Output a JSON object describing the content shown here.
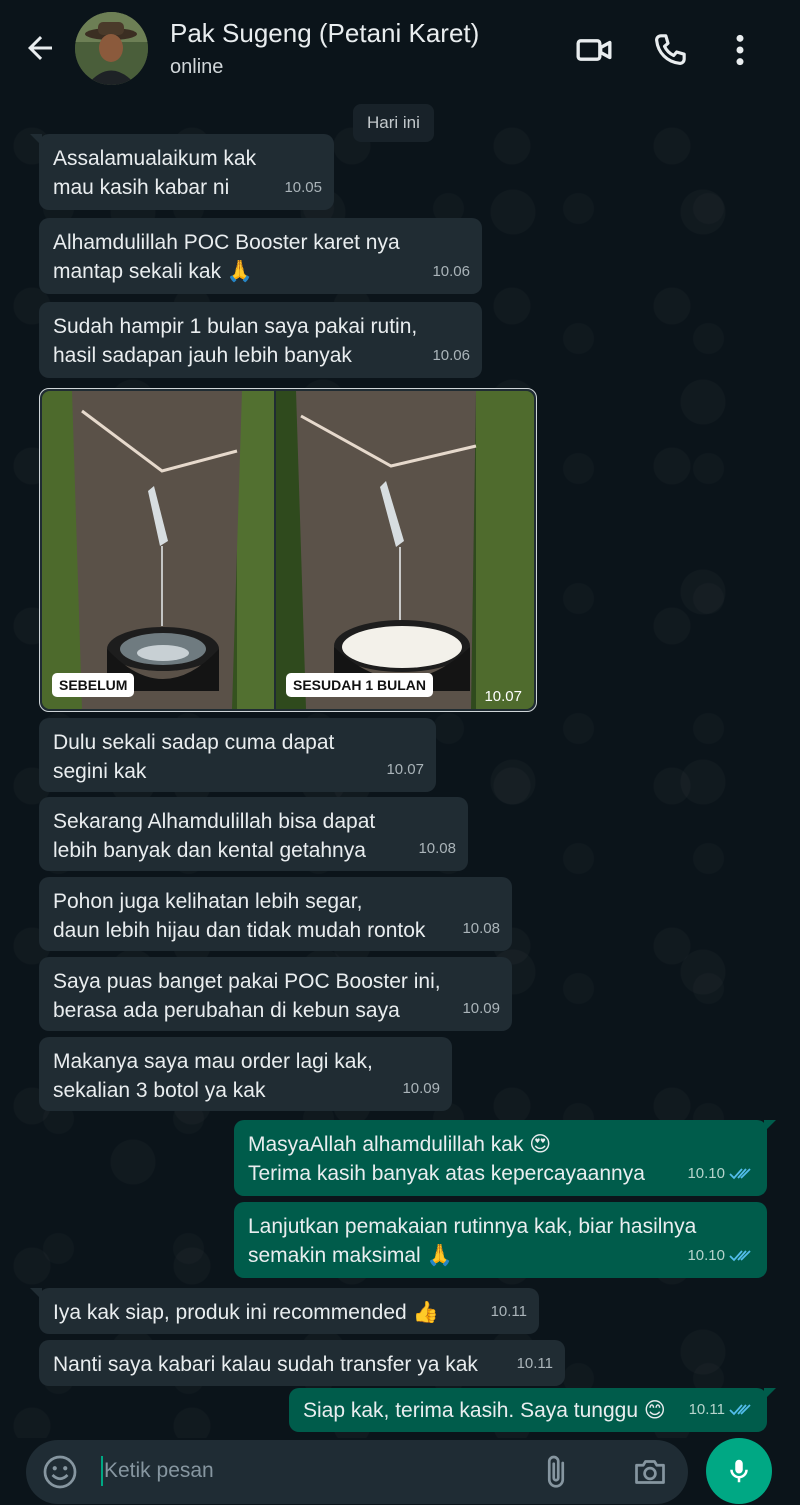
{
  "header": {
    "contact_name": "Pak Sugeng (Petani Karet)",
    "status": "online",
    "icons": [
      "back-arrow-icon",
      "video-call-icon",
      "phone-icon",
      "more-vert-icon"
    ]
  },
  "date_chip": "Hari ini",
  "messages": [
    {
      "dir": "in",
      "text": "Assalamualaikum kak\nmau kasih kabar ni",
      "time": "10.05"
    },
    {
      "dir": "in",
      "text": "Alhamdulillah POC Booster karet nya\nmantap sekali kak 🙏",
      "time": "10.06"
    },
    {
      "dir": "in",
      "text": "Sudah hampir 1 bulan saya pakai rutin,\nhasil sadapan jauh lebih banyak",
      "time": "10.06"
    },
    {
      "dir": "in",
      "text": "Dulu sekali sadap cuma dapat\nsegini kak",
      "time": "10.07"
    },
    {
      "dir": "in",
      "text": "Sekarang Alhamdulillah bisa dapat\nlebih banyak dan kental getahnya",
      "time": "10.08"
    },
    {
      "dir": "in",
      "text": "Pohon juga kelihatan lebih segar,\ndaun lebih hijau dan tidak mudah rontok",
      "time": "10.08"
    },
    {
      "dir": "in",
      "text": "Saya puas banget pakai POC Booster ini,\nberasa ada perubahan di kebun saya",
      "time": "10.09"
    },
    {
      "dir": "in",
      "text": "Makanya saya mau order lagi kak,\nsekalian 3 botol ya kak",
      "time": "10.09"
    },
    {
      "dir": "out",
      "text": "MasyaAllah alhamdulillah kak 😍\nTerima kasih banyak atas kepercayaannya",
      "time": "10.10"
    },
    {
      "dir": "out",
      "text": "Lanjutkan pemakaian rutinnya kak, biar hasilnya\nsemakin maksimal 🙏",
      "time": "10.10"
    },
    {
      "dir": "in",
      "text": "Iya kak siap, produk ini recommended 👍",
      "time": "10.11"
    },
    {
      "dir": "in",
      "text": "Nanti saya kabari kalau sudah transfer ya kak",
      "time": "10.11"
    },
    {
      "dir": "out",
      "text": "Siap kak, terima kasih. Saya tunggu 😊",
      "time": "10.11"
    }
  ],
  "image_message": {
    "left_label": "SEBELUM",
    "right_label": "SESUDAH 1 BULAN",
    "time": "10.07"
  },
  "input": {
    "placeholder": "Ketik pesan",
    "icons": [
      "emoji-icon",
      "attach-icon",
      "camera-icon",
      "mic-icon"
    ]
  },
  "colors": {
    "background": "#0b141a",
    "incoming_bubble": "#202c33",
    "outgoing_bubble": "#005c4b",
    "accent": "#00a884",
    "read_ticks": "#53bdeb"
  }
}
